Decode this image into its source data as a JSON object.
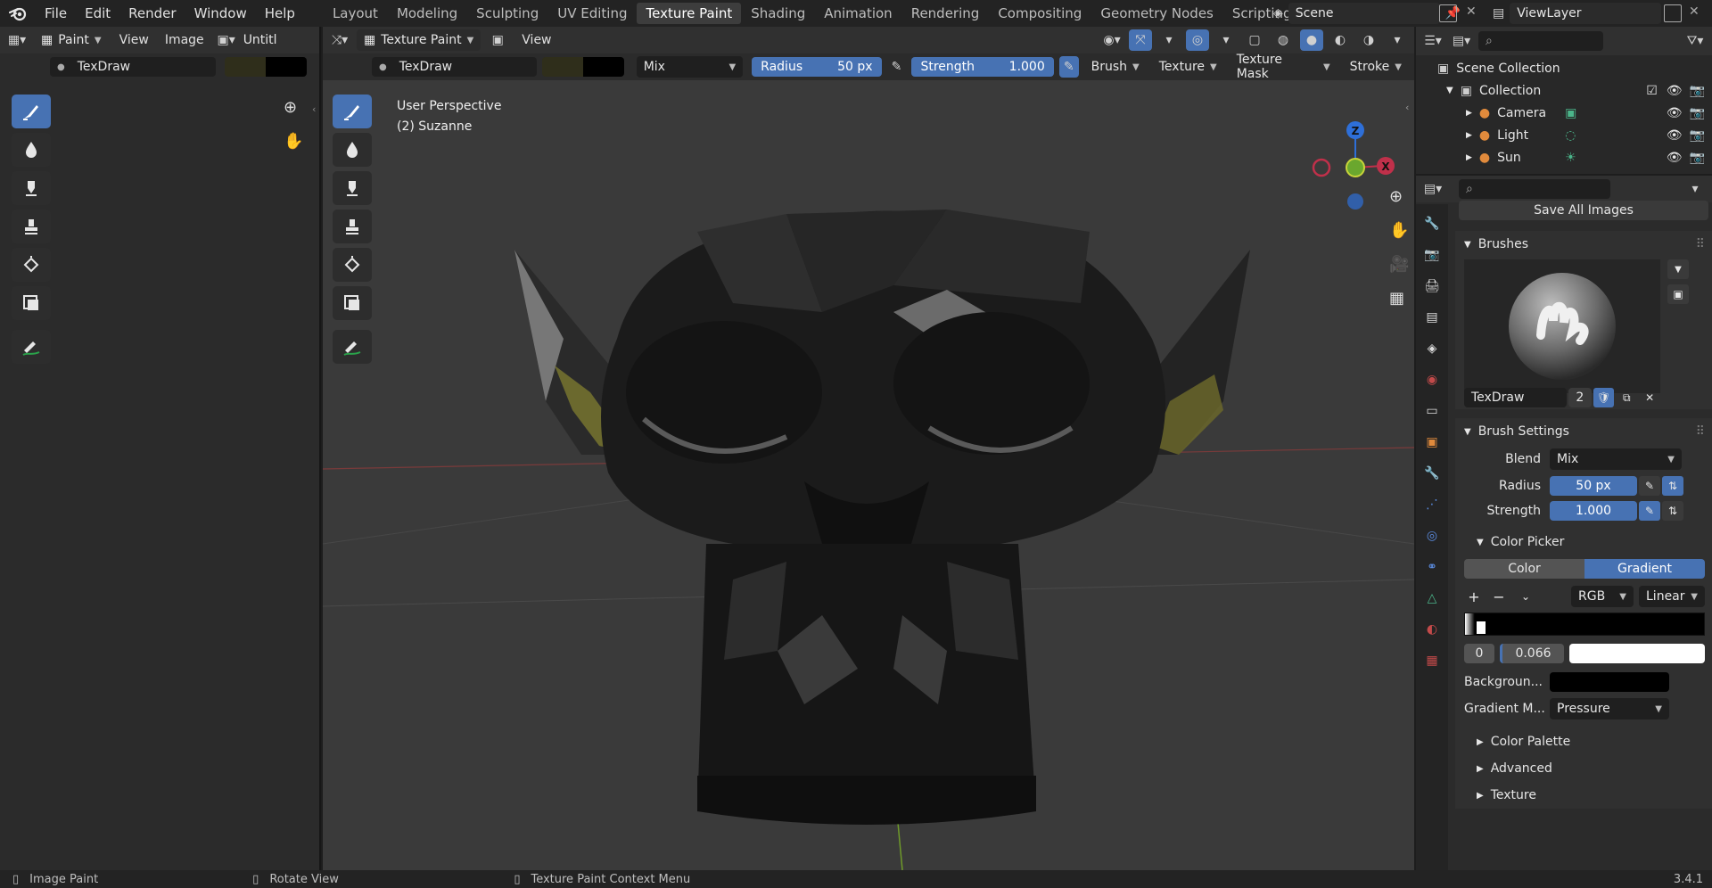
{
  "menu": [
    "File",
    "Edit",
    "Render",
    "Window",
    "Help"
  ],
  "workspaces": [
    {
      "label": "Layout",
      "active": false
    },
    {
      "label": "Modeling",
      "active": false
    },
    {
      "label": "Sculpting",
      "active": false
    },
    {
      "label": "UV Editing",
      "active": false
    },
    {
      "label": "Texture Paint",
      "active": true
    },
    {
      "label": "Shading",
      "active": false
    },
    {
      "label": "Animation",
      "active": false
    },
    {
      "label": "Rendering",
      "active": false
    },
    {
      "label": "Compositing",
      "active": false
    },
    {
      "label": "Geometry Nodes",
      "active": false
    },
    {
      "label": "Scripting",
      "active": false
    }
  ],
  "scene": {
    "name": "Scene",
    "view_layer": "ViewLayer"
  },
  "image_editor": {
    "mode": "Paint",
    "view": "View",
    "image": "Image",
    "image_name": "Untitl",
    "brush": "TexDraw"
  },
  "viewport": {
    "mode": "Texture Paint",
    "view": "View",
    "brush": "TexDraw",
    "blend": "Mix",
    "radius_label": "Radius",
    "radius_value": "50 px",
    "strength_label": "Strength",
    "strength_value": "1.000",
    "menus": [
      "Brush",
      "Texture",
      "Texture Mask",
      "Stroke"
    ],
    "overlay_title": "User Perspective",
    "overlay_object": "(2) Suzanne",
    "gizmo": {
      "z": "Z",
      "x": "X"
    }
  },
  "outliner": {
    "root": "Scene Collection",
    "collection": "Collection",
    "items": [
      "Camera",
      "Light",
      "Sun"
    ]
  },
  "properties": {
    "save_all": "Save All Images",
    "brushes_title": "Brushes",
    "brush_name": "TexDraw",
    "brush_users": "2",
    "brush_settings_title": "Brush Settings",
    "blend_label": "Blend",
    "blend_value": "Mix",
    "radius_label": "Radius",
    "radius_value": "50 px",
    "strength_label": "Strength",
    "strength_value": "1.000",
    "color_picker_title": "Color Picker",
    "color_tab": "Color",
    "gradient_tab": "Gradient",
    "color_mode": "RGB",
    "interp": "Linear",
    "stop_index": "0",
    "stop_pos": "0.066",
    "background_label": "Backgroun...",
    "gradient_mode_label": "Gradient M...",
    "gradient_mode_value": "Pressure",
    "collapsed": [
      "Color Palette",
      "Advanced",
      "Texture"
    ]
  },
  "status": {
    "left": "Image Paint",
    "middle": "Rotate View",
    "right": "Texture Paint Context Menu",
    "version": "3.4.1"
  },
  "colors": {
    "accent": "#4772b3",
    "bg": "#1d1d1d",
    "header": "#2f2f2f",
    "viewport": "#3a3a3a"
  }
}
